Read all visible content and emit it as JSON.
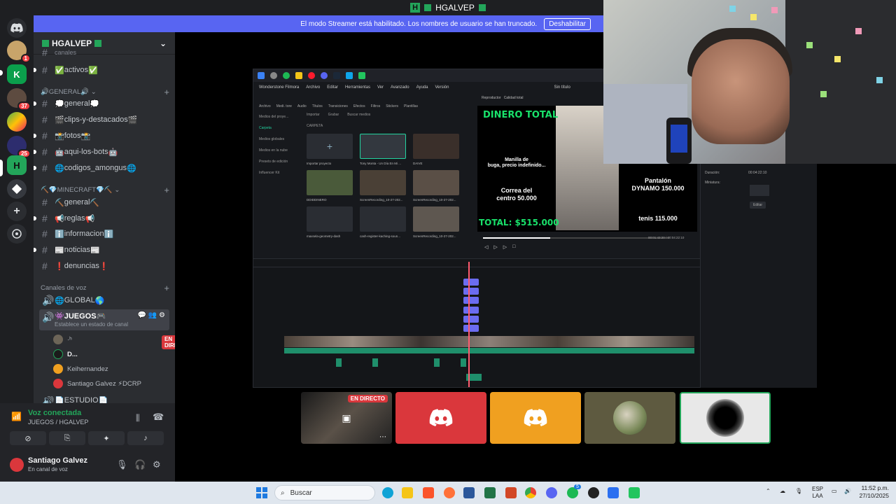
{
  "titlebar": {
    "title": "HGALVEP"
  },
  "streamer_banner": {
    "text": "El modo Streamer está habilitado. Los nombres de usuario se han truncado.",
    "button": "Deshabilitar"
  },
  "rail": {
    "badges": {
      "srv1": "1",
      "srv3": "37",
      "srv5": "25"
    }
  },
  "server": {
    "name": "HGALVEP",
    "partial_top": "canales",
    "channels_top": [
      {
        "name": "activos",
        "emoji": "✅"
      }
    ],
    "cat_general": "GENERAL",
    "general_channels": [
      {
        "name": "general",
        "emoji": "💭"
      },
      {
        "name": "clips-y-destacados",
        "emoji": "🎬"
      },
      {
        "name": "fotos",
        "emoji": "📸"
      },
      {
        "name": "aqui-los-bots",
        "emoji": "🤖"
      },
      {
        "name": "codigos_amongus",
        "emoji": "🌐"
      }
    ],
    "cat_minecraft": "MINECRAFT",
    "minecraft_channels": [
      {
        "name": "general",
        "emoji": "⛏️"
      },
      {
        "name": "reglas",
        "emoji": "📢"
      },
      {
        "name": "informacion",
        "emoji": "ℹ️"
      },
      {
        "name": "noticias",
        "emoji": "📰"
      },
      {
        "name": "denuncias",
        "emoji": "❗"
      }
    ],
    "cat_voice": "Canales de voz",
    "voice_global": "GLOBAL",
    "voice_juegos": "JUEGOS",
    "voice_status_hint": "Establece un estado de canal",
    "voice_users": [
      {
        "name": "·ʰ",
        "live": true
      },
      {
        "name": "D..."
      },
      {
        "name": "Keihernandez"
      },
      {
        "name": "Santiago Galvez ⚡DCRP"
      }
    ],
    "live_label": "EN DIRECTO",
    "voice_estudio": "ESTUDIO"
  },
  "voice_panel": {
    "status": "Voz conectada",
    "channel": "JUEGOS / HGALVEP",
    "user": "Santiago Galvez",
    "user_status": "En canal de voz"
  },
  "filmora": {
    "app_title": "Wonderstone Filmora",
    "menu": [
      "Archivo",
      "Editar",
      "Herramientas",
      "Ver",
      "Avanzado",
      "Ayuda",
      "Versión"
    ],
    "title_center": "Sin título",
    "tools": [
      "Archivo",
      "Medi. tore",
      "Audio",
      "Títulos",
      "Transiciones",
      "Efectos",
      "Filtros",
      "Stickers",
      "Plantillas"
    ],
    "preview_label": "Reproductor",
    "quality": "Calidad total",
    "leftnav": [
      "Medios del proye...",
      "Carpeta",
      "Medios globales",
      "Medios en la nube",
      "Presets de edición",
      "Influencer Kit"
    ],
    "media_header": "CARPETA",
    "media_search": "Buscar medios",
    "import_btn": "Importar",
    "record_btn": "Grabar",
    "media_items": [
      "Importar proyecto",
      "Tony Monta - Un Día En Mi ...",
      "DAIVE",
      "DDIDDINERO",
      "ScreenRecording_10-27-202...",
      "ScreenRecording_10-27-202...",
      "maxsela-geometry-dash",
      "cash-register-kaching-soun...",
      "ScreenRecording_10-27-202..."
    ],
    "overlay": {
      "title": "DINERO TOTAL",
      "item1": "Manilla de\nbuga, precio indefinido...",
      "item2": "Correa del\ncentro 50.000",
      "item3": "Pantalón\nDYNAMO 150.000",
      "item4": "tenis 115.000",
      "total": "TOTAL: $515.000"
    },
    "time_current": "00:01:43:20",
    "time_total": "00:04:22:10",
    "props": {
      "duration_label": "Duración:",
      "duration_value": "00:04:22:10",
      "mini_label": "Miniatura:",
      "edit_btn": "Editar"
    }
  },
  "tiles": {
    "live": "EN DIRECTO"
  },
  "taskbar": {
    "search": "Buscar",
    "lang": "ESP",
    "lang2": "LAA",
    "time": "11:52 p.m.",
    "date": "27/10/2025",
    "badge_app": "5"
  },
  "colors": {
    "discord_blurple": "#5865f2",
    "discord_red": "#da373c",
    "discord_yellow": "#f0a020",
    "discord_green": "#23a55a",
    "filmora_green": "#19e26b"
  }
}
